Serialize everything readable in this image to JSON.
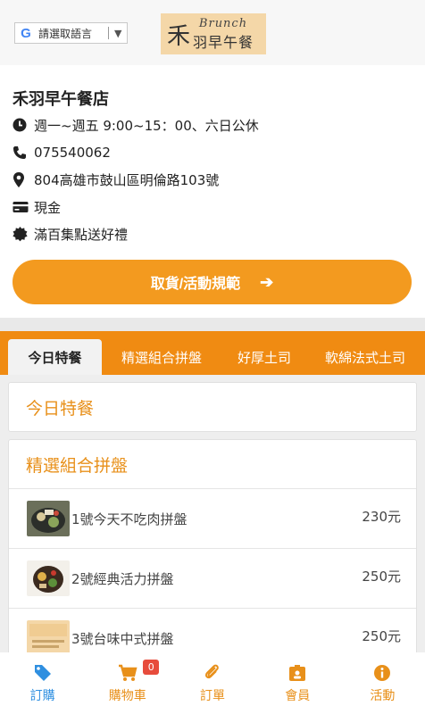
{
  "header": {
    "language_select": "請選取語言",
    "logo": {
      "brunch": "Brunch",
      "name": "羽早午餐",
      "mark": "禾"
    }
  },
  "store": {
    "name": "禾羽早午餐店",
    "hours": "週一~週五 9:00~15：00、六日公休",
    "phone": "075540062",
    "address": "804高雄市鼓山區明倫路103號",
    "payment": "現金",
    "promo": "滿百集點送好禮",
    "rules_button": "取貨/活動規範"
  },
  "tabs": [
    {
      "label": "今日特餐",
      "active": true
    },
    {
      "label": "精選組合拼盤"
    },
    {
      "label": "好厚土司"
    },
    {
      "label": "軟綿法式土司"
    }
  ],
  "sections": [
    {
      "title": "今日特餐",
      "items": []
    },
    {
      "title": "精選組合拼盤",
      "items": [
        {
          "name": "1號今天不吃肉拼盤",
          "price": "230元"
        },
        {
          "name": "2號經典活力拼盤",
          "price": "250元"
        },
        {
          "name": "3號台味中式拼盤",
          "price": "250元"
        }
      ]
    }
  ],
  "bottom_nav": [
    {
      "label": "訂購",
      "icon": "tag-icon",
      "active": true
    },
    {
      "label": "購物車",
      "icon": "cart-icon",
      "badge": "0"
    },
    {
      "label": "訂單",
      "icon": "paperclip-icon"
    },
    {
      "label": "會員",
      "icon": "id-badge-icon"
    },
    {
      "label": "活動",
      "icon": "info-icon"
    }
  ],
  "colors": {
    "accent": "#f39a1f",
    "tab_bar": "#f08b12",
    "active_nav": "#2f8fe0"
  }
}
